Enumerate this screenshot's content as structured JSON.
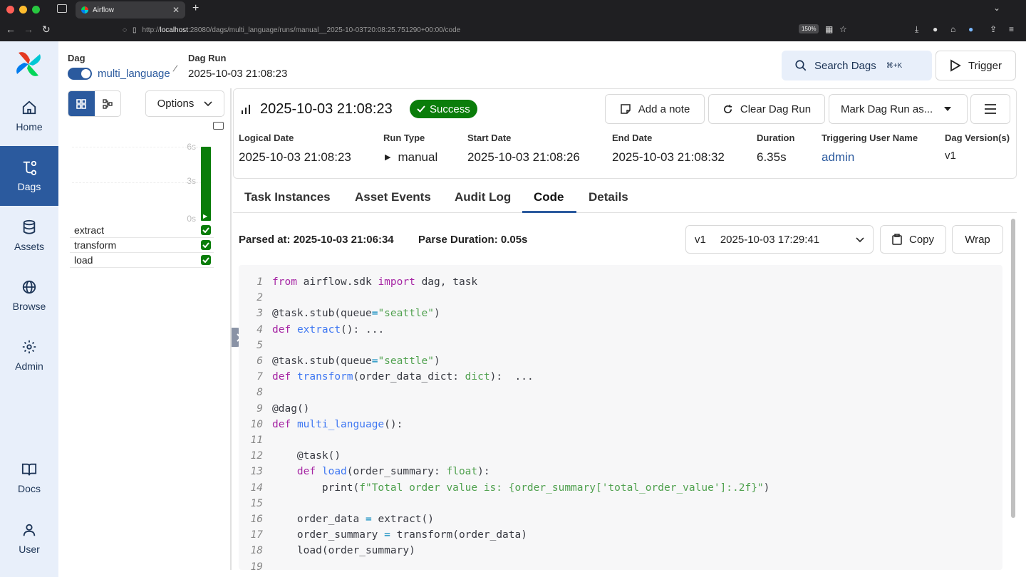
{
  "browser": {
    "tab_title": "Airflow",
    "url_prefix": "http://",
    "url_host": "localhost",
    "url_rest": ":28080/dags/multi_language/runs/manual__2025-10-03T20:08:25.751290+00:00/code",
    "zoom": "150%"
  },
  "nav": {
    "home": "Home",
    "dags": "Dags",
    "assets": "Assets",
    "browse": "Browse",
    "admin": "Admin",
    "docs": "Docs",
    "user": "User"
  },
  "header": {
    "dag_label": "Dag",
    "dag_name": "multi_language",
    "run_label": "Dag Run",
    "run_value": "2025-10-03 21:08:23",
    "search_label": "Search Dags",
    "search_kbd": "⌘+K",
    "trigger_label": "Trigger"
  },
  "left_panel": {
    "options_label": "Options",
    "axis": [
      "6s",
      "3s",
      "0s"
    ],
    "run_duration_fraction": 1.0,
    "tasks": [
      "extract",
      "transform",
      "load"
    ]
  },
  "run": {
    "title": "2025-10-03 21:08:23",
    "status": "Success",
    "add_note": "Add a note",
    "clear": "Clear Dag Run",
    "mark": "Mark Dag Run as...",
    "meta": {
      "logical_date_label": "Logical Date",
      "logical_date": "2025-10-03 21:08:23",
      "run_type_label": "Run Type",
      "run_type": "manual",
      "start_date_label": "Start Date",
      "start_date": "2025-10-03 21:08:26",
      "end_date_label": "End Date",
      "end_date": "2025-10-03 21:08:32",
      "duration_label": "Duration",
      "duration": "6.35s",
      "trigger_user_label": "Triggering User Name",
      "trigger_user": "admin",
      "dag_version_label": "Dag Version(s)",
      "dag_version": "v1"
    }
  },
  "tabs": {
    "task_instances": "Task Instances",
    "asset_events": "Asset Events",
    "audit_log": "Audit Log",
    "code": "Code",
    "details": "Details"
  },
  "code_view": {
    "parsed_at": "Parsed at: 2025-10-03 21:06:34",
    "parse_duration": "Parse Duration: 0.05s",
    "version": "v1",
    "version_date": "2025-10-03 17:29:41",
    "copy_label": "Copy",
    "wrap_label": "Wrap",
    "lines": [
      "from airflow.sdk import dag, task",
      "",
      "@task.stub(queue=\"seattle\")",
      "def extract(): ...",
      "",
      "@task.stub(queue=\"seattle\")",
      "def transform(order_data_dict: dict):  ...",
      "",
      "@dag()",
      "def multi_language():",
      "",
      "    @task()",
      "    def load(order_summary: float):",
      "        print(f\"Total order value is: {order_summary['total_order_value']:.2f}\")",
      "",
      "    order_data = extract()",
      "    order_summary = transform(order_data)",
      "    load(order_summary)",
      ""
    ]
  },
  "colors": {
    "primary": "#2b5a9e",
    "success": "#0a7d0a",
    "nav_bg": "#e8effa"
  }
}
